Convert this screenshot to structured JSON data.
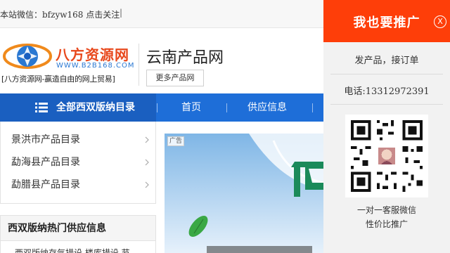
{
  "topbar": {
    "notice": "本站微信：bfzyw168 点击关注",
    "separator": "|"
  },
  "logo": {
    "name": "八方资源网",
    "url_text": "WWW.B2B168.COM",
    "slogan": "[八方资源网-赢造自由的网上贸易]"
  },
  "site": {
    "title": "云南产品网",
    "more_button": "更多产品网"
  },
  "nav": {
    "catalog_label": "全部西双版纳目录",
    "items": [
      "首页",
      "供应信息"
    ]
  },
  "categories": [
    "景洪市产品目录",
    "勐海县产品目录",
    "勐腊县产品目录"
  ],
  "hot_supply": {
    "title": "西双版纳热门供应信息",
    "first_item": "西双版纳存气措设  楼库措设  节"
  },
  "banner": {
    "ad_tag": "广告"
  },
  "promo": {
    "title": "我也要推广",
    "close_symbol": "X",
    "line1": "发产品，接订单",
    "phone": "电话:13312972391",
    "caption1": "一对一客服微信",
    "caption2": "性价比推广"
  },
  "colors": {
    "nav_blue": "#1e6ed8",
    "promo_red": "#fe3e09",
    "logo_orange": "#e8481c",
    "logo_blue": "#2a78d2"
  }
}
